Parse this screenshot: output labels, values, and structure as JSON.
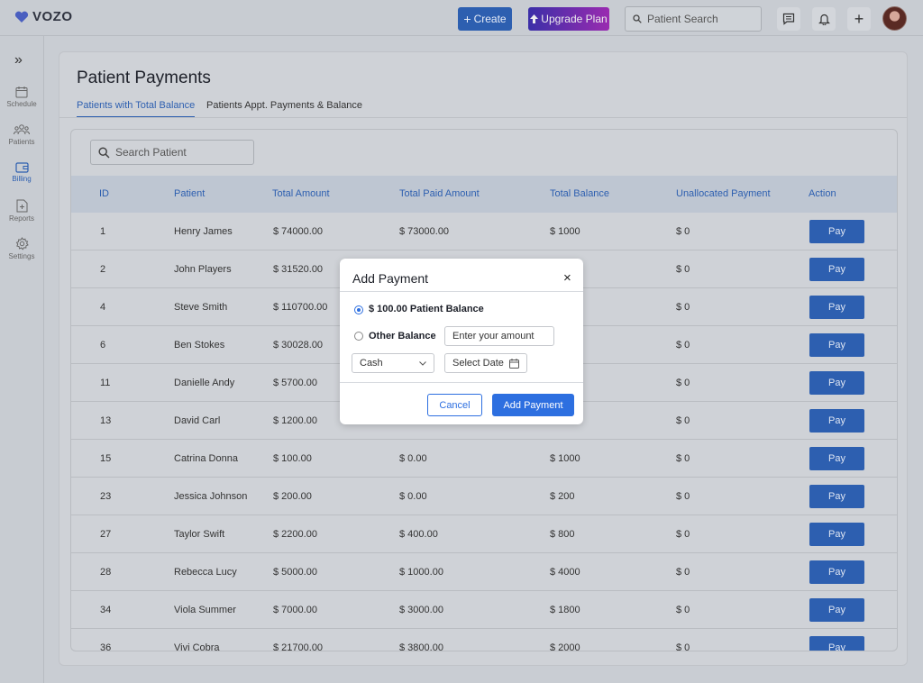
{
  "app": {
    "name": "VOZO"
  },
  "topbar": {
    "create_label": "Create",
    "upgrade_label": "Upgrade Plan",
    "search_placeholder": "Patient Search"
  },
  "sidebar": {
    "items": [
      {
        "label": "Schedule",
        "icon": "calendar-icon"
      },
      {
        "label": "Patients",
        "icon": "people-icon"
      },
      {
        "label": "Billing",
        "icon": "wallet-icon",
        "active": true
      },
      {
        "label": "Reports",
        "icon": "report-icon"
      },
      {
        "label": "Settings",
        "icon": "gear-icon"
      }
    ]
  },
  "page": {
    "title": "Patient Payments",
    "tabs": [
      {
        "label": "Patients with Total Balance",
        "active": true
      },
      {
        "label": "Patients Appt. Payments & Balance",
        "active": false
      }
    ],
    "search_placeholder": "Search Patient"
  },
  "table": {
    "headers": [
      "ID",
      "Patient",
      "Total Amount",
      "Total Paid Amount",
      "Total Balance",
      "Unallocated Payment",
      "Action"
    ],
    "pay_label": "Pay",
    "rows": [
      {
        "id": "1",
        "patient": "Henry James",
        "total": "$ 74000.00",
        "paid": "$ 73000.00",
        "balance": "$ 1000",
        "unallocated": "$ 0"
      },
      {
        "id": "2",
        "patient": "John Players",
        "total": "$ 31520.00",
        "paid": "",
        "balance": "",
        "unallocated": "$ 0"
      },
      {
        "id": "4",
        "patient": "Steve Smith",
        "total": "$ 110700.00",
        "paid": "",
        "balance": "",
        "unallocated": "$ 0"
      },
      {
        "id": "6",
        "patient": "Ben Stokes",
        "total": "$ 30028.00",
        "paid": "",
        "balance": "",
        "unallocated": "$ 0"
      },
      {
        "id": "11",
        "patient": "Danielle Andy",
        "total": "$ 5700.00",
        "paid": "",
        "balance": "",
        "unallocated": "$ 0"
      },
      {
        "id": "13",
        "patient": "David Carl",
        "total": "$ 1200.00",
        "paid": "",
        "balance": "",
        "unallocated": "$ 0"
      },
      {
        "id": "15",
        "patient": "Catrina Donna",
        "total": "$ 100.00",
        "paid": "$ 0.00",
        "balance": "$ 1000",
        "unallocated": "$ 0"
      },
      {
        "id": "23",
        "patient": "Jessica Johnson",
        "total": "$ 200.00",
        "paid": "$ 0.00",
        "balance": "$ 200",
        "unallocated": "$ 0"
      },
      {
        "id": "27",
        "patient": "Taylor Swift",
        "total": "$ 2200.00",
        "paid": "$ 400.00",
        "balance": "$ 800",
        "unallocated": "$ 0"
      },
      {
        "id": "28",
        "patient": "Rebecca Lucy",
        "total": "$ 5000.00",
        "paid": "$ 1000.00",
        "balance": "$ 4000",
        "unallocated": "$ 0"
      },
      {
        "id": "34",
        "patient": "Viola Summer",
        "total": "$ 7000.00",
        "paid": "$ 3000.00",
        "balance": "$ 1800",
        "unallocated": "$ 0"
      },
      {
        "id": "36",
        "patient": "Vivi Cobra",
        "total": "$ 21700.00",
        "paid": "$ 3800.00",
        "balance": "$ 2000",
        "unallocated": "$ 0"
      }
    ]
  },
  "modal": {
    "title": "Add Payment",
    "close": "×",
    "option_balance": "$ 100.00 Patient Balance",
    "option_other": "Other Balance",
    "amount_placeholder": "Enter your amount",
    "method": "Cash",
    "date_placeholder": "Select Date",
    "cancel_label": "Cancel",
    "submit_label": "Add Payment"
  },
  "colors": {
    "primary": "#2d5fb0",
    "modal_primary": "#2d6fe0",
    "overlay": "#c9cdd3"
  }
}
